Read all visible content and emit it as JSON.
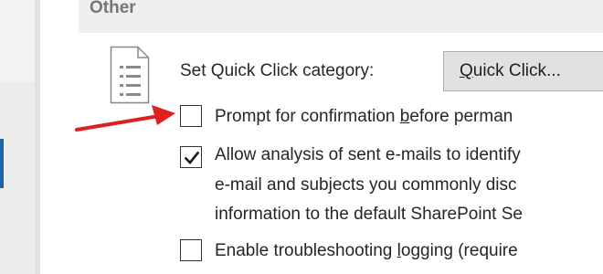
{
  "section": {
    "title": "Other"
  },
  "quick_click": {
    "label": "Set Quick Click category:",
    "button_label": "Quick Click..."
  },
  "options": [
    {
      "id": "prompt-confirmation",
      "checked": false,
      "text_before": "Prompt for confirmation ",
      "accel": "b",
      "text_after": "efore perman"
    },
    {
      "id": "allow-analysis",
      "checked": true,
      "lines": [
        "Allow analysis of sent e-mails to identify",
        "e-mail and subjects you commonly disc",
        "information to the default SharePoint Se"
      ]
    },
    {
      "id": "troubleshooting-logging",
      "checked": false,
      "text_before": "Enable troubleshooting ",
      "accel": "l",
      "text_after": "ogging (require"
    }
  ],
  "icons": {
    "document": "document-list-icon",
    "annotation": "red-arrow-annotation",
    "check": "checkmark-icon"
  },
  "colors": {
    "annotation_arrow": "#e02020",
    "nav_accent": "#1e63a6",
    "section_header_bg": "#efefef",
    "section_title": "#767676"
  }
}
